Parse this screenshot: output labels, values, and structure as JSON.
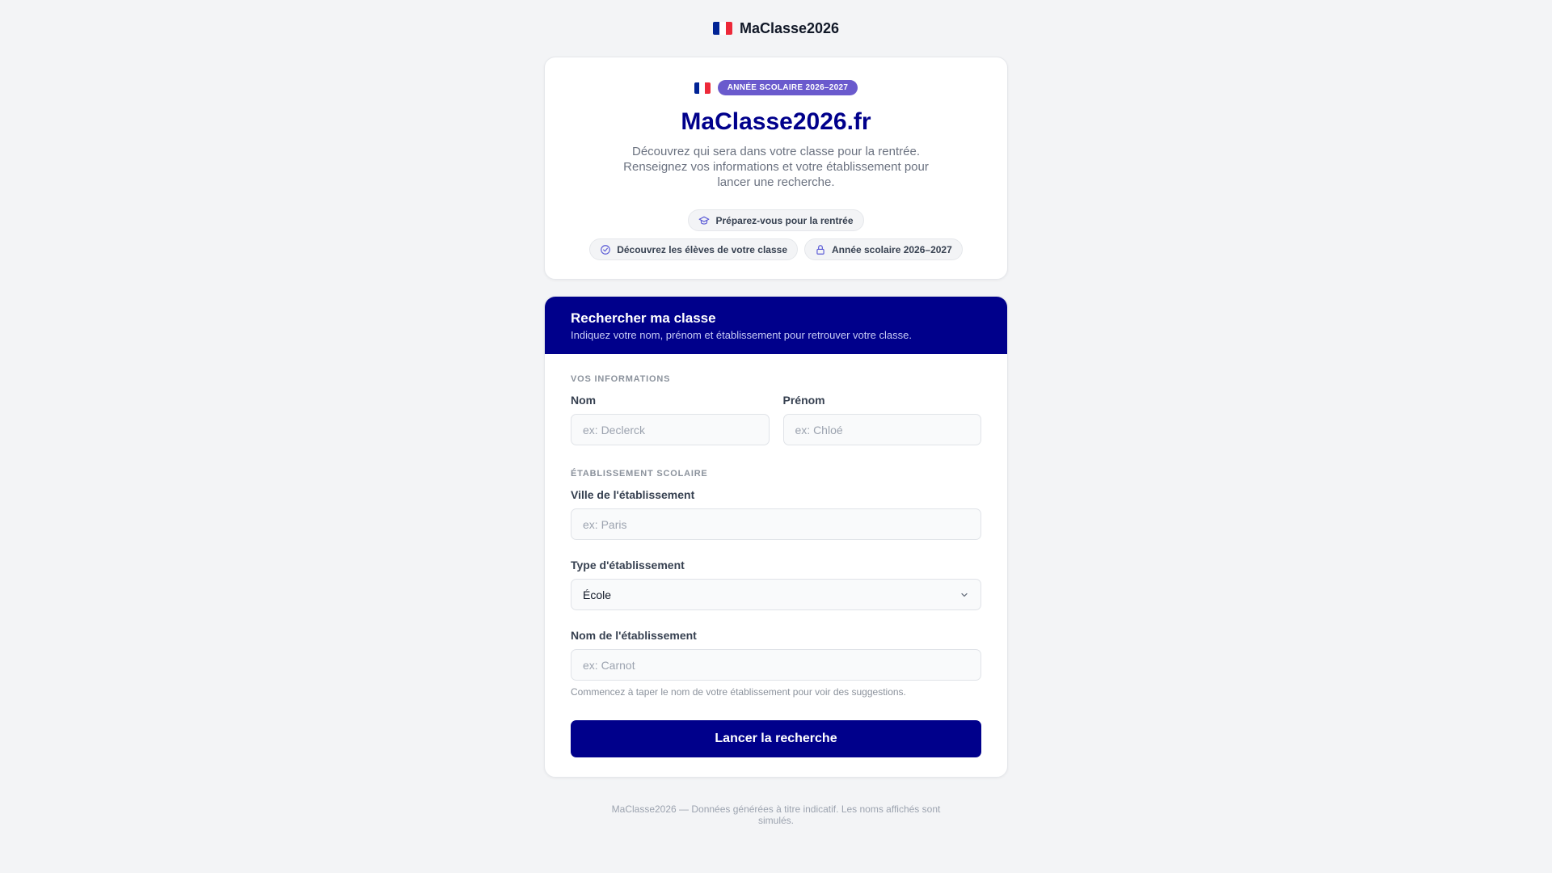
{
  "header": {
    "brand": "MaClasse2026"
  },
  "hero": {
    "badge": "ANNÉE SCOLAIRE 2026–2027",
    "title": "MaClasse2026.fr",
    "description": "Découvrez qui sera dans votre classe pour la rentrée. Renseignez vos informations et votre établissement pour lancer une recherche.",
    "chips": [
      {
        "label": "Préparez-vous pour la rentrée",
        "icon": "graduation-cap-icon"
      },
      {
        "label": "Découvrez les élèves de votre classe",
        "icon": "check-circle-icon"
      },
      {
        "label": "Année scolaire 2026–2027",
        "icon": "lock-icon"
      }
    ]
  },
  "search": {
    "title": "Rechercher ma classe",
    "subtitle": "Indiquez votre nom, prénom et établissement pour retrouver votre classe.",
    "section_info": "VOS INFORMATIONS",
    "nom_label": "Nom",
    "nom_placeholder": "ex: Declerck",
    "prenom_label": "Prénom",
    "prenom_placeholder": "ex: Chloé",
    "section_school": "ÉTABLISSEMENT SCOLAIRE",
    "ville_label": "Ville de l'établissement",
    "ville_placeholder": "ex: Paris",
    "type_label": "Type d'établissement",
    "type_value": "École",
    "etab_label": "Nom de l'établissement",
    "etab_placeholder": "ex: Carnot",
    "hint": "Commencez à taper le nom de votre établissement pour voir des suggestions.",
    "submit": "Lancer la recherche"
  },
  "footer": {
    "text": "MaClasse2026 — Données générées à titre indicatif. Les noms affichés sont simulés."
  },
  "colors": {
    "primary": "#00008b",
    "badge": "#6a5acd",
    "background": "#f3f4f6"
  }
}
